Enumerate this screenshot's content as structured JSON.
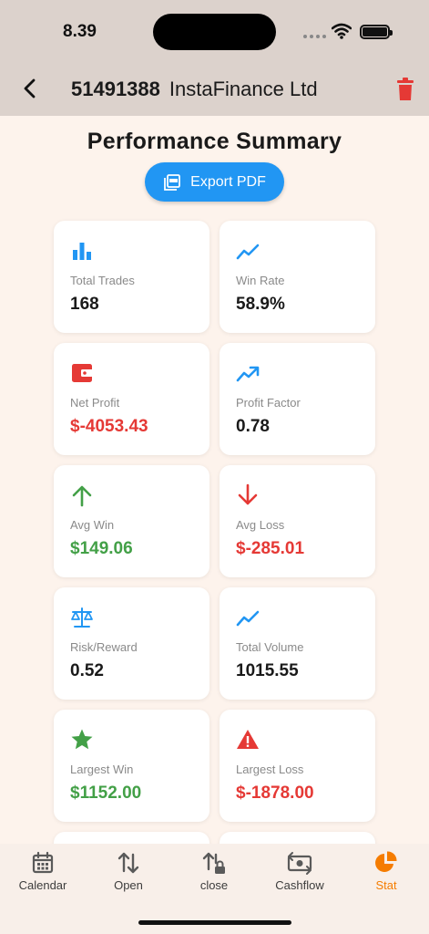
{
  "status": {
    "time": "8.39"
  },
  "header": {
    "account_number": "51491388",
    "broker": "InstaFinance Ltd"
  },
  "page": {
    "title": "Performance Summary",
    "export_label": "Export PDF"
  },
  "colors": {
    "accent": "#2196f3",
    "negative": "#e53935",
    "positive": "#43a047",
    "active_tab": "#f57c00"
  },
  "stats": [
    {
      "label": "Total Trades",
      "value": "168",
      "icon": "bar-chart-icon"
    },
    {
      "label": "Win Rate",
      "value": "58.9%",
      "icon": "trending-line-icon"
    },
    {
      "label": "Net Profit",
      "value": "$-4053.43",
      "icon": "wallet-icon"
    },
    {
      "label": "Profit Factor",
      "value": "0.78",
      "icon": "trending-up-icon"
    },
    {
      "label": "Avg Win",
      "value": "$149.06",
      "icon": "arrow-up-icon"
    },
    {
      "label": "Avg Loss",
      "value": "$-285.01",
      "icon": "arrow-down-icon"
    },
    {
      "label": "Risk/Reward",
      "value": "0.52",
      "icon": "balance-scale-icon"
    },
    {
      "label": "Total Volume",
      "value": "1015.55",
      "icon": "trending-line-icon"
    },
    {
      "label": "Largest Win",
      "value": "$1152.00",
      "icon": "star-icon"
    },
    {
      "label": "Largest Loss",
      "value": "$-1878.00",
      "icon": "warning-icon"
    }
  ],
  "nav": [
    {
      "label": "Calendar",
      "icon": "calendar-icon"
    },
    {
      "label": "Open",
      "icon": "swap-arrows-icon"
    },
    {
      "label": "close",
      "icon": "swap-lock-icon"
    },
    {
      "label": "Cashflow",
      "icon": "money-icon"
    },
    {
      "label": "Stat",
      "icon": "pie-chart-icon",
      "active": true
    }
  ]
}
